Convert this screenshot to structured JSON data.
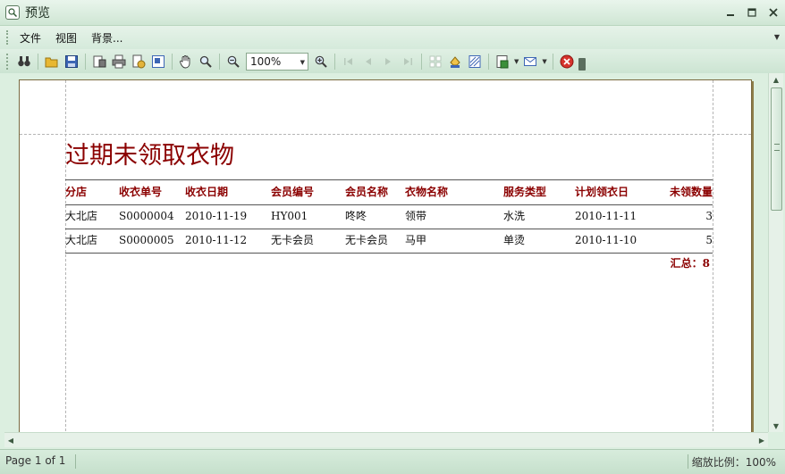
{
  "window": {
    "title": "预览",
    "icon": "preview-doc-icon"
  },
  "menu": {
    "items": [
      "文件",
      "视图",
      "背景..."
    ]
  },
  "toolbar": {
    "zoom_value": "100%",
    "icons": [
      "find-icon",
      "open-icon",
      "save-icon",
      "page-setup-icon",
      "print-icon",
      "quick-print-icon",
      "scale-icon",
      "hand-icon",
      "magnifier-icon",
      "zoom-out-icon",
      "zoom-in-icon",
      "first-page-icon",
      "prev-page-icon",
      "next-page-icon",
      "last-page-icon",
      "multipage-icon",
      "color-icon",
      "watermark-icon",
      "export-icon",
      "email-icon",
      "close-preview-icon"
    ]
  },
  "report": {
    "title": "过期未领取衣物",
    "columns": [
      "分店",
      "收衣单号",
      "收衣日期",
      "会员编号",
      "会员名称",
      "衣物名称",
      "服务类型",
      "计划领衣日",
      "未领数量"
    ],
    "rows": [
      [
        "大北店",
        "S0000004",
        "2010-11-19",
        "HY001",
        "咚咚",
        "领带",
        "水洗",
        "2010-11-11",
        "3"
      ],
      [
        "大北店",
        "S0000005",
        "2010-11-12",
        "无卡会员",
        "无卡会员",
        "马甲",
        "单烫",
        "2010-11-10",
        "5"
      ]
    ],
    "total_label": "汇总：8"
  },
  "status": {
    "page": "Page 1 of 1",
    "zoom": "缩放比例：100%"
  }
}
